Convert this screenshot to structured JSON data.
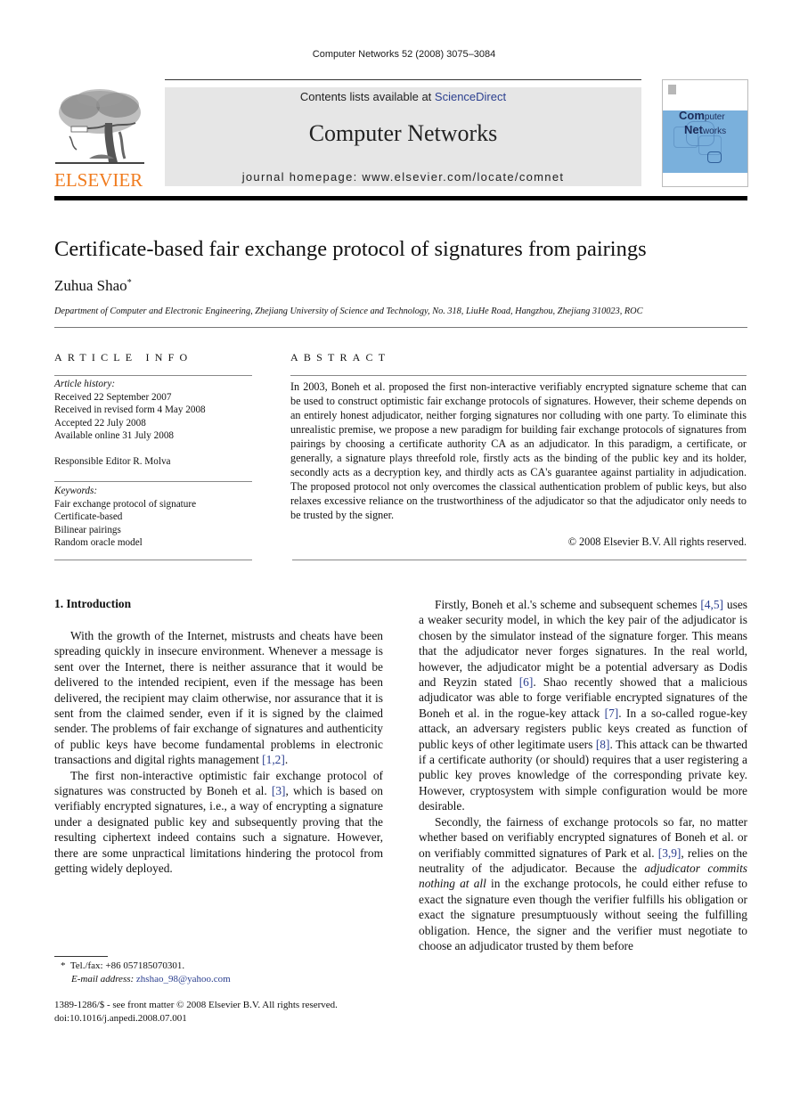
{
  "header": {
    "citation": "Computer Networks 52 (2008) 3075–3084",
    "contents_prefix": "Contents lists available at ",
    "contents_link": "ScienceDirect",
    "journal_name": "Computer Networks",
    "homepage": "journal homepage: www.elsevier.com/locate/comnet",
    "publisher_logo": "ELSEVIER",
    "cover_title_line1_big": "Com",
    "cover_title_line1_small": "puter",
    "cover_title_line2_big": "Net",
    "cover_title_line2_small": "works",
    "colors": {
      "elsevier_orange": "#f07b1e",
      "link_blue": "#2b3f8f",
      "banner_gray": "#e6e6e6",
      "cover_blue": "#7ab0dc"
    }
  },
  "article": {
    "title": "Certificate-based fair exchange protocol of signatures from pairings",
    "author": "Zuhua Shao",
    "author_mark": "*",
    "affiliation": "Department of Computer and Electronic Engineering, Zhejiang University of Science and Technology, No. 318, LiuHe Road, Hangzhou, Zhejiang 310023, ROC"
  },
  "article_info": {
    "label": "ARTICLE INFO",
    "history_heading": "Article history:",
    "history": [
      "Received 22 September 2007",
      "Received in revised form 4 May 2008",
      "Accepted 22 July 2008",
      "Available online 31 July 2008"
    ],
    "editor": "Responsible Editor R. Molva",
    "keywords_heading": "Keywords:",
    "keywords": [
      "Fair exchange protocol of signature",
      "Certificate-based",
      "Bilinear pairings",
      "Random oracle model"
    ]
  },
  "abstract": {
    "label": "ABSTRACT",
    "text": "In 2003, Boneh et al. proposed the first non-interactive verifiably encrypted signature scheme that can be used to construct optimistic fair exchange protocols of signatures. However, their scheme depends on an entirely honest adjudicator, neither forging signatures nor colluding with one party. To eliminate this unrealistic premise, we propose a new paradigm for building fair exchange protocols of signatures from pairings by choosing a certificate authority CA as an adjudicator. In this paradigm, a certificate, or generally, a signature plays threefold role, firstly acts as the binding of the public key and its holder, secondly acts as a decryption key, and thirdly acts as CA's guarantee against partiality in adjudication. The proposed protocol not only overcomes the classical authentication problem of public keys, but also relaxes excessive reliance on the trustworthiness of the adjudicator so that the adjudicator only needs to be trusted by the signer.",
    "copyright": "© 2008 Elsevier B.V. All rights reserved."
  },
  "body": {
    "section_heading": "1.  Introduction",
    "left": {
      "p1": "With the growth of the Internet, mistrusts and cheats have been spreading quickly in insecure environment. Whenever a message is sent over the Internet, there is neither assurance that it would be delivered to the intended recipient, even if the message has been delivered, the recipient may claim otherwise, nor assurance that it is sent from the claimed sender, even if it is signed by the claimed sender. The problems of fair exchange of signatures and authenticity of public keys have become fundamental problems in electronic transactions and digital rights management ",
      "p1_cite": "[1,2]",
      "p1_end": ".",
      "p2_a": "The first non-interactive optimistic fair exchange protocol of signatures was constructed by Boneh et al. ",
      "p2_cite": "[3]",
      "p2_b": ", which is based on verifiably encrypted signatures, i.e., a way of encrypting a signature under a designated public key and subsequently proving that the resulting ciphertext indeed contains such a signature. However, there are some unpractical limitations hindering the protocol from getting widely deployed."
    },
    "right": {
      "p1_a": "Firstly, Boneh et al.'s scheme and subsequent schemes ",
      "p1_cite1": "[4,5]",
      "p1_b": " uses a weaker security model, in which the key pair of the adjudicator is chosen by the simulator instead of the signature forger. This means that the adjudicator never forges signatures. In the real world, however, the adjudicator might be a potential adversary as Dodis and Reyzin stated ",
      "p1_cite2": "[6]",
      "p1_c": ". Shao recently showed that a malicious adjudicator was able to forge verifiable encrypted signatures of the Boneh et al. in the rogue-key attack ",
      "p1_cite3": "[7]",
      "p1_d": ". In a so-called rogue-key attack, an adversary registers public keys created as function of public keys of other legitimate users ",
      "p1_cite4": "[8]",
      "p1_e": ". This attack can be thwarted if a certificate authority (or should) requires that a user registering a public key proves knowledge of the corresponding private key. However, cryptosystem with simple configuration would be more desirable.",
      "p2_a": "Secondly, the fairness of exchange protocols so far, no matter whether based on verifiably encrypted signatures of Boneh et al. or on verifiably committed signatures of Park et al. ",
      "p2_cite": "[3,9]",
      "p2_b": ", relies on the neutrality of the adjudicator. Because the ",
      "p2_em": "adjudicator commits nothing at all",
      "p2_c": " in the exchange protocols, he could either refuse to exact the signature even though the verifier fulfills his obligation or exact the signature presumptuously without seeing the fulfilling obligation. Hence, the signer and the verifier must negotiate to choose an adjudicator trusted by them before"
    }
  },
  "footnote": {
    "mark": "*",
    "tel": "Tel./fax: +86 057185070301.",
    "email_label": "E-mail address:",
    "email": "zhshao_98@yahoo.com"
  },
  "front_matter": {
    "issn_line": "1389-1286/$ - see front matter © 2008 Elsevier B.V. All rights reserved.",
    "doi": "doi:10.1016/j.anpedi.2008.07.001"
  }
}
